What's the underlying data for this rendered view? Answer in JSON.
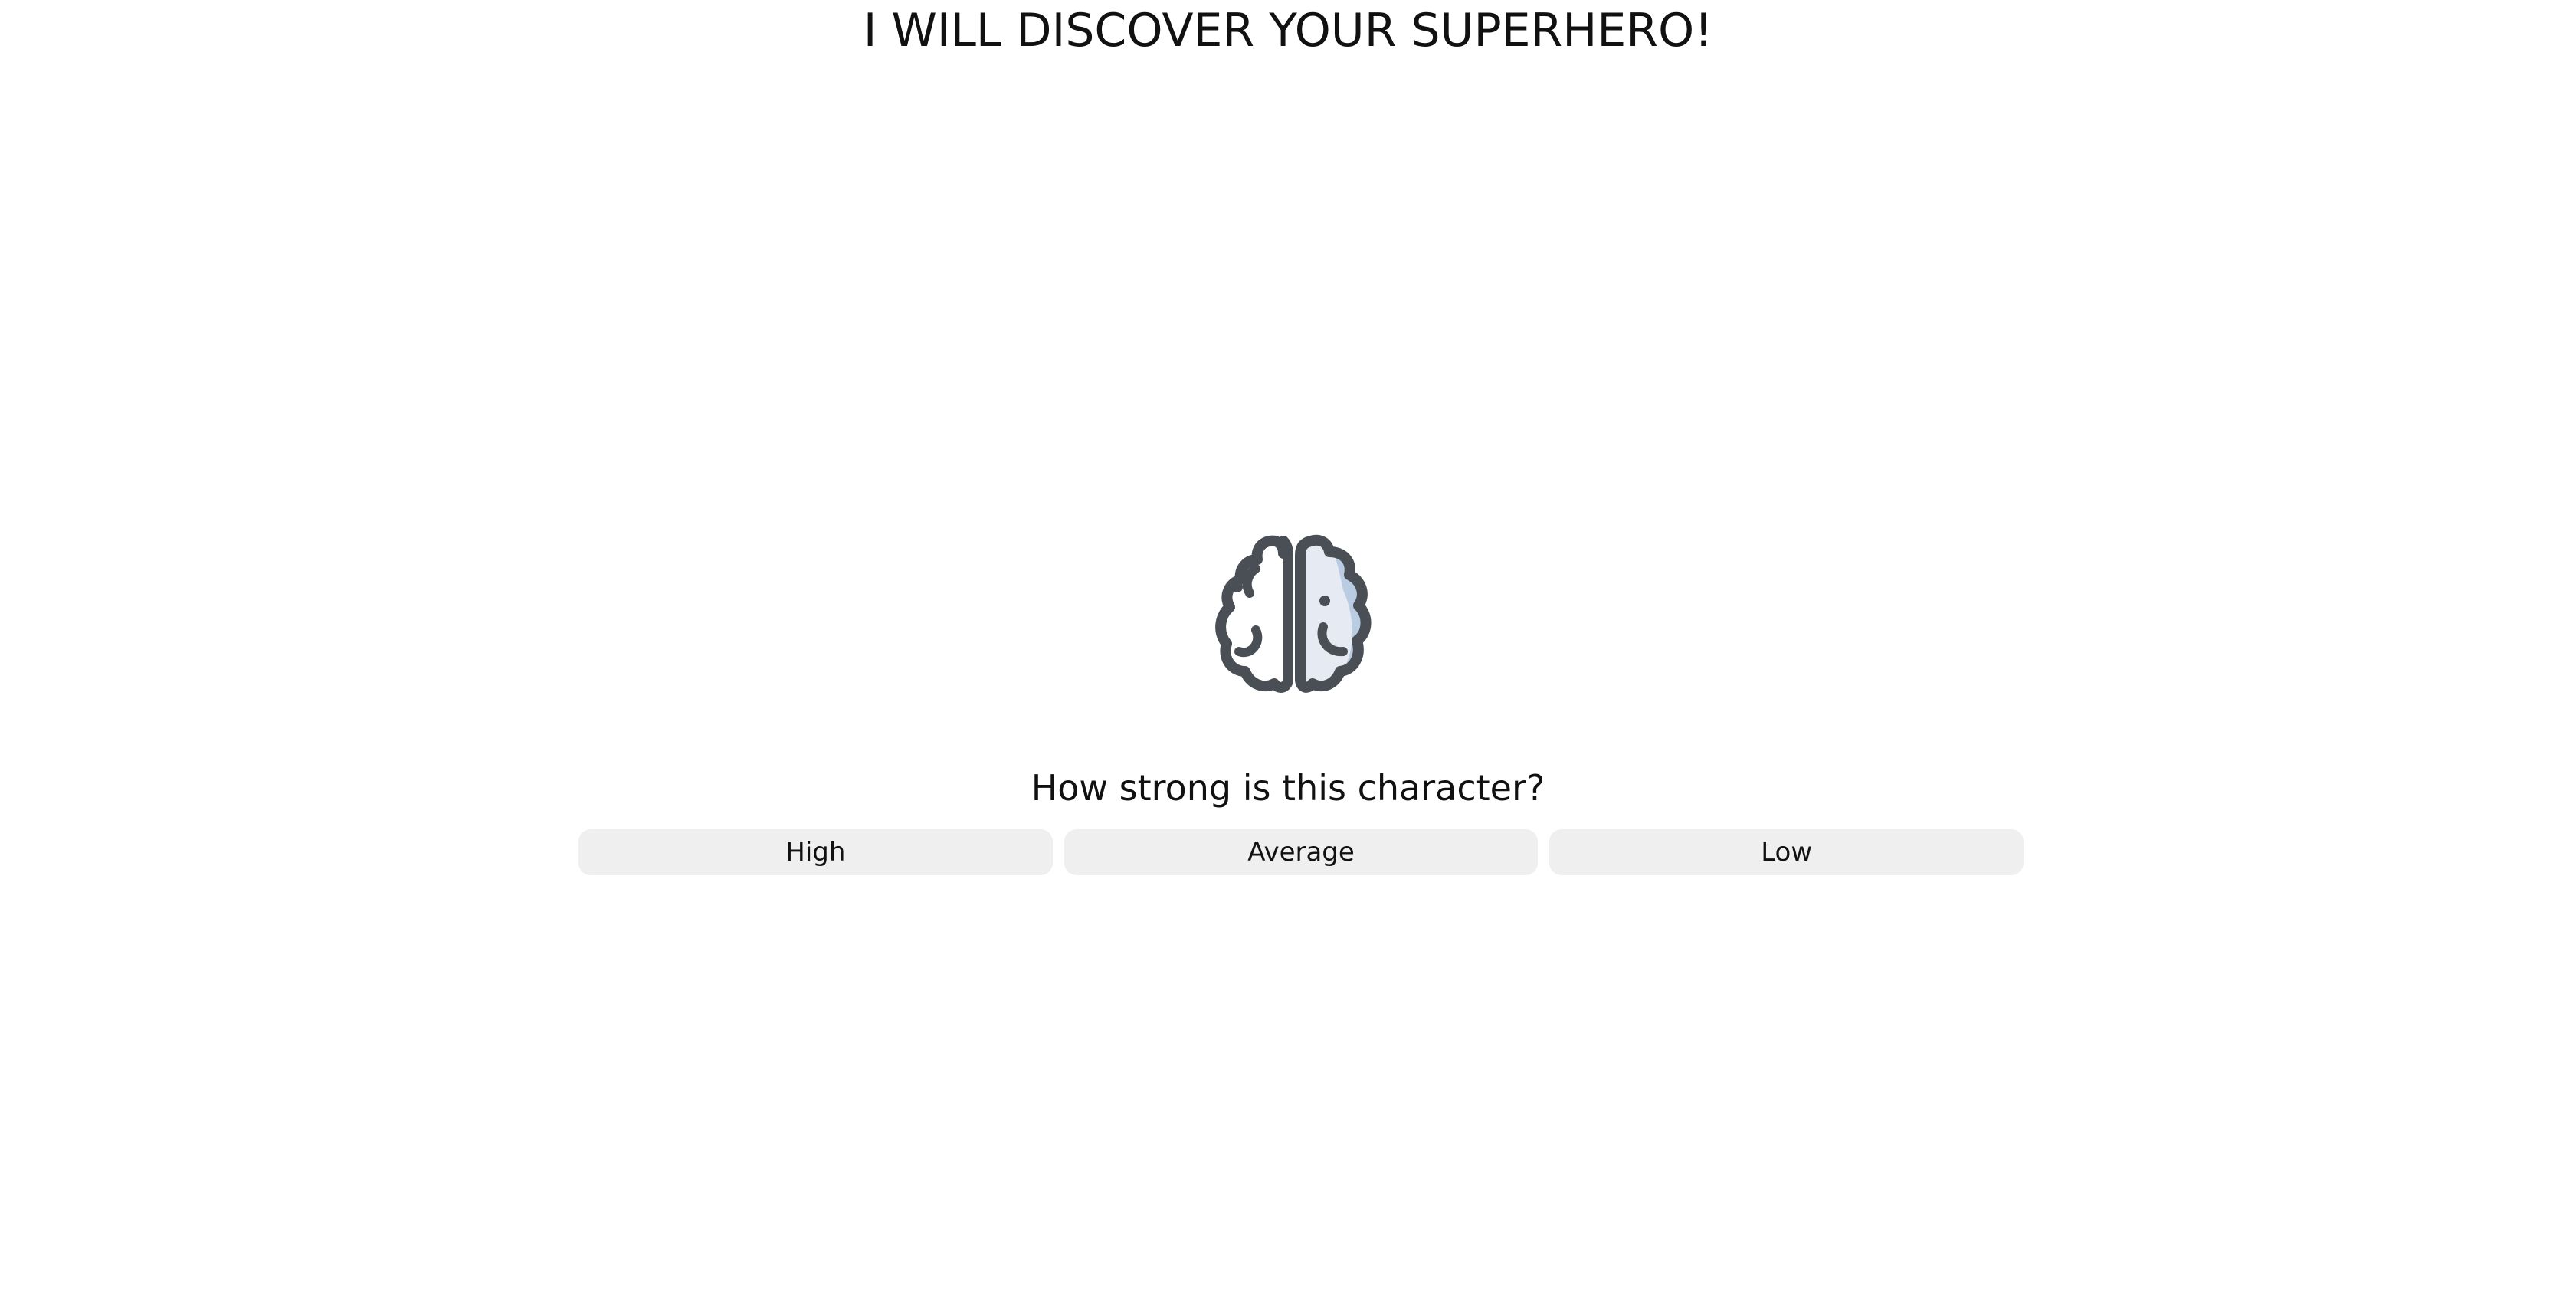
{
  "header": {
    "title": "I WILL DISCOVER YOUR SUPERHERO!"
  },
  "quiz": {
    "icon": "brain-icon",
    "question": "How strong is this character?",
    "answers": [
      {
        "label": "High"
      },
      {
        "label": "Average"
      },
      {
        "label": "Low"
      }
    ]
  },
  "colors": {
    "background": "#ffffff",
    "text": "#111111",
    "button_bg": "#efefef",
    "icon_stroke": "#4a4e55",
    "icon_fill_light": "#e6ebf3",
    "icon_fill_shade": "#b9cce1"
  }
}
